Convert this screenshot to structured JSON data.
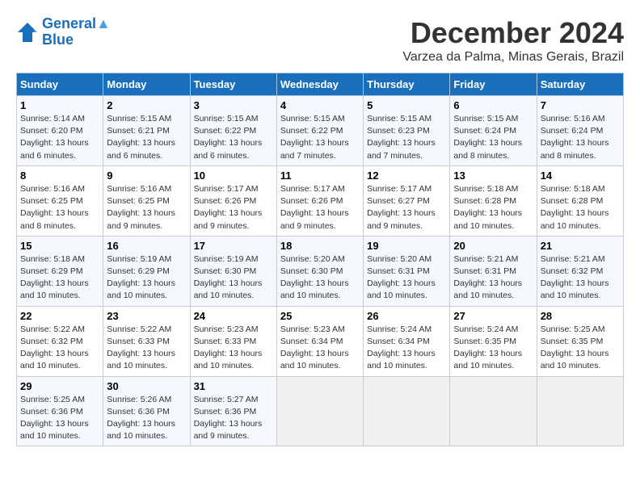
{
  "header": {
    "logo_line1": "General",
    "logo_line2": "Blue",
    "month_title": "December 2024",
    "location": "Varzea da Palma, Minas Gerais, Brazil"
  },
  "weekdays": [
    "Sunday",
    "Monday",
    "Tuesday",
    "Wednesday",
    "Thursday",
    "Friday",
    "Saturday"
  ],
  "weeks": [
    [
      {
        "day": "1",
        "sunrise": "5:14 AM",
        "sunset": "6:20 PM",
        "daylight": "13 hours and 6 minutes."
      },
      {
        "day": "2",
        "sunrise": "5:15 AM",
        "sunset": "6:21 PM",
        "daylight": "13 hours and 6 minutes."
      },
      {
        "day": "3",
        "sunrise": "5:15 AM",
        "sunset": "6:22 PM",
        "daylight": "13 hours and 6 minutes."
      },
      {
        "day": "4",
        "sunrise": "5:15 AM",
        "sunset": "6:22 PM",
        "daylight": "13 hours and 7 minutes."
      },
      {
        "day": "5",
        "sunrise": "5:15 AM",
        "sunset": "6:23 PM",
        "daylight": "13 hours and 7 minutes."
      },
      {
        "day": "6",
        "sunrise": "5:15 AM",
        "sunset": "6:24 PM",
        "daylight": "13 hours and 8 minutes."
      },
      {
        "day": "7",
        "sunrise": "5:16 AM",
        "sunset": "6:24 PM",
        "daylight": "13 hours and 8 minutes."
      }
    ],
    [
      {
        "day": "8",
        "sunrise": "5:16 AM",
        "sunset": "6:25 PM",
        "daylight": "13 hours and 8 minutes."
      },
      {
        "day": "9",
        "sunrise": "5:16 AM",
        "sunset": "6:25 PM",
        "daylight": "13 hours and 9 minutes."
      },
      {
        "day": "10",
        "sunrise": "5:17 AM",
        "sunset": "6:26 PM",
        "daylight": "13 hours and 9 minutes."
      },
      {
        "day": "11",
        "sunrise": "5:17 AM",
        "sunset": "6:26 PM",
        "daylight": "13 hours and 9 minutes."
      },
      {
        "day": "12",
        "sunrise": "5:17 AM",
        "sunset": "6:27 PM",
        "daylight": "13 hours and 9 minutes."
      },
      {
        "day": "13",
        "sunrise": "5:18 AM",
        "sunset": "6:28 PM",
        "daylight": "13 hours and 10 minutes."
      },
      {
        "day": "14",
        "sunrise": "5:18 AM",
        "sunset": "6:28 PM",
        "daylight": "13 hours and 10 minutes."
      }
    ],
    [
      {
        "day": "15",
        "sunrise": "5:18 AM",
        "sunset": "6:29 PM",
        "daylight": "13 hours and 10 minutes."
      },
      {
        "day": "16",
        "sunrise": "5:19 AM",
        "sunset": "6:29 PM",
        "daylight": "13 hours and 10 minutes."
      },
      {
        "day": "17",
        "sunrise": "5:19 AM",
        "sunset": "6:30 PM",
        "daylight": "13 hours and 10 minutes."
      },
      {
        "day": "18",
        "sunrise": "5:20 AM",
        "sunset": "6:30 PM",
        "daylight": "13 hours and 10 minutes."
      },
      {
        "day": "19",
        "sunrise": "5:20 AM",
        "sunset": "6:31 PM",
        "daylight": "13 hours and 10 minutes."
      },
      {
        "day": "20",
        "sunrise": "5:21 AM",
        "sunset": "6:31 PM",
        "daylight": "13 hours and 10 minutes."
      },
      {
        "day": "21",
        "sunrise": "5:21 AM",
        "sunset": "6:32 PM",
        "daylight": "13 hours and 10 minutes."
      }
    ],
    [
      {
        "day": "22",
        "sunrise": "5:22 AM",
        "sunset": "6:32 PM",
        "daylight": "13 hours and 10 minutes."
      },
      {
        "day": "23",
        "sunrise": "5:22 AM",
        "sunset": "6:33 PM",
        "daylight": "13 hours and 10 minutes."
      },
      {
        "day": "24",
        "sunrise": "5:23 AM",
        "sunset": "6:33 PM",
        "daylight": "13 hours and 10 minutes."
      },
      {
        "day": "25",
        "sunrise": "5:23 AM",
        "sunset": "6:34 PM",
        "daylight": "13 hours and 10 minutes."
      },
      {
        "day": "26",
        "sunrise": "5:24 AM",
        "sunset": "6:34 PM",
        "daylight": "13 hours and 10 minutes."
      },
      {
        "day": "27",
        "sunrise": "5:24 AM",
        "sunset": "6:35 PM",
        "daylight": "13 hours and 10 minutes."
      },
      {
        "day": "28",
        "sunrise": "5:25 AM",
        "sunset": "6:35 PM",
        "daylight": "13 hours and 10 minutes."
      }
    ],
    [
      {
        "day": "29",
        "sunrise": "5:25 AM",
        "sunset": "6:36 PM",
        "daylight": "13 hours and 10 minutes."
      },
      {
        "day": "30",
        "sunrise": "5:26 AM",
        "sunset": "6:36 PM",
        "daylight": "13 hours and 10 minutes."
      },
      {
        "day": "31",
        "sunrise": "5:27 AM",
        "sunset": "6:36 PM",
        "daylight": "13 hours and 9 minutes."
      },
      null,
      null,
      null,
      null
    ]
  ]
}
